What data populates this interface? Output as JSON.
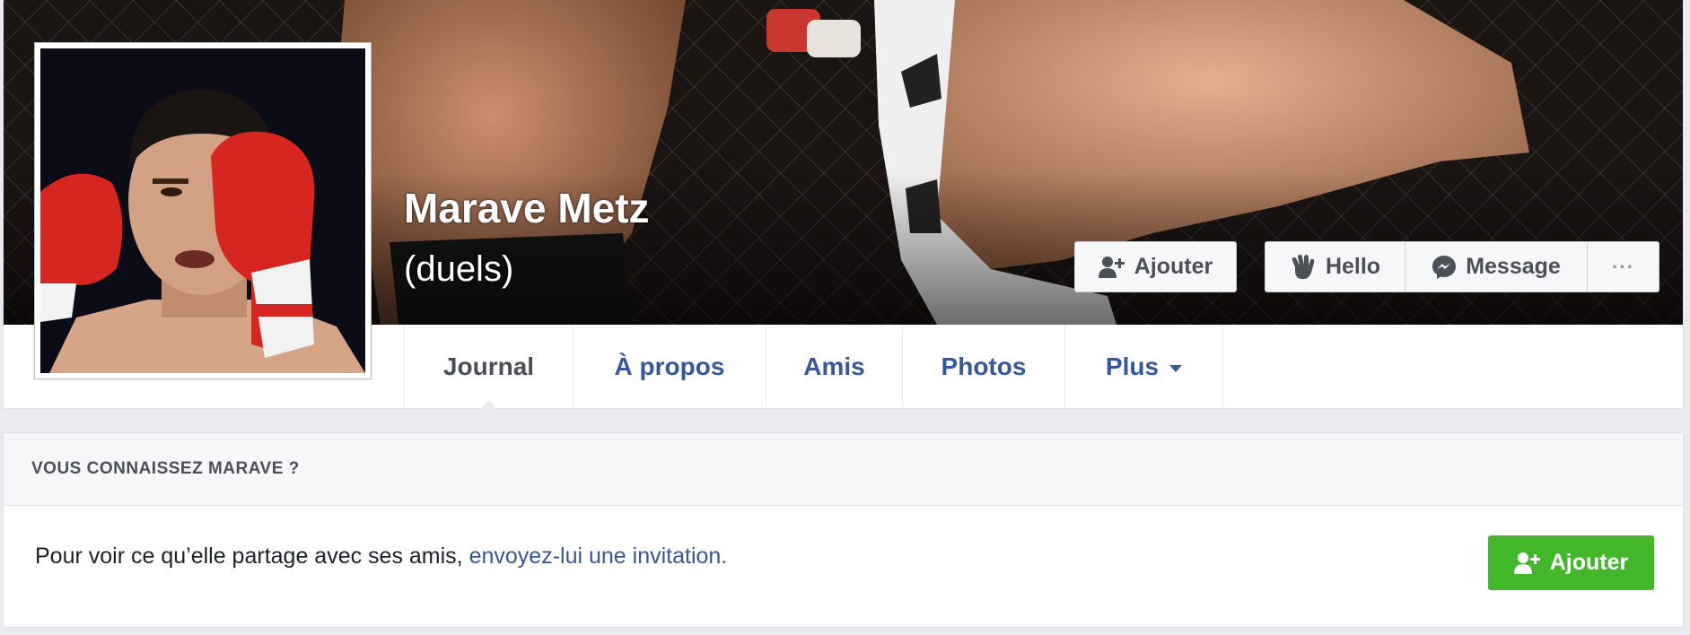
{
  "profile": {
    "name": "Marave Metz",
    "alternate_name": "(duels)"
  },
  "cover_actions": {
    "add_friend": {
      "label": "Ajouter",
      "icon": "add-friend-icon"
    },
    "hello": {
      "label": "Hello",
      "icon": "wave-hand-icon"
    },
    "message": {
      "label": "Message",
      "icon": "messenger-icon"
    },
    "more": {
      "label": "···",
      "icon": "more-dots-icon"
    }
  },
  "tabs": [
    {
      "label": "Journal",
      "active": true
    },
    {
      "label": "À propos",
      "active": false
    },
    {
      "label": "Amis",
      "active": false
    },
    {
      "label": "Photos",
      "active": false
    },
    {
      "label": "Plus",
      "active": false
    }
  ],
  "friend_request": {
    "heading": "VOUS CONNAISSEZ MARAVE ?",
    "text_prefix": "Pour voir ce qu’elle partage avec ses amis, ",
    "link_text": "envoyez-lui une invitation",
    "text_suffix": ".",
    "button_label": "Ajouter"
  },
  "colors": {
    "link_blue": "#365899",
    "add_green": "#42b72a",
    "page_bg": "#e9ebee"
  }
}
